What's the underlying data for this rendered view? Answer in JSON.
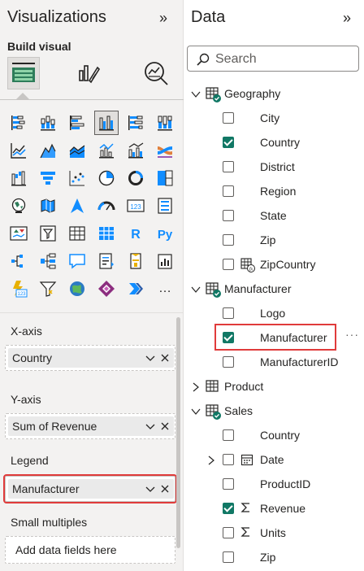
{
  "viz": {
    "title": "Visualizations",
    "collapse_glyph": "»",
    "build_label": "Build visual",
    "wells": {
      "xaxis_label": "X-axis",
      "xaxis_value": "Country",
      "yaxis_label": "Y-axis",
      "yaxis_value": "Sum of Revenue",
      "legend_label": "Legend",
      "legend_value": "Manufacturer",
      "small_multiples_label": "Small multiples",
      "small_multiples_placeholder": "Add data fields here"
    },
    "grid_icons": [
      "stacked-bar-chart-icon",
      "stacked-column-chart-icon",
      "clustered-bar-chart-icon",
      "clustered-column-chart-icon",
      "100-stacked-bar-chart-icon",
      "100-stacked-column-chart-icon",
      "line-chart-icon",
      "area-chart-icon",
      "stacked-area-chart-icon",
      "line-and-column-chart-icon",
      "line-and-clustered-column-chart-icon",
      "ribbon-chart-icon",
      "waterfall-chart-icon",
      "funnel-chart-icon",
      "scatter-chart-icon",
      "pie-chart-icon",
      "donut-chart-icon",
      "treemap-icon",
      "map-icon",
      "filled-map-icon",
      "azure-map-icon",
      "gauge-icon",
      "card-icon",
      "multi-row-card-icon",
      "kpi-icon",
      "slicer-icon",
      "table-icon",
      "matrix-icon",
      "r-visual-icon",
      "python-visual-icon",
      "decomposition-tree-icon",
      "key-influencers-icon",
      "qa-icon",
      "smart-narrative-icon",
      "paginated-report-icon",
      "power-apps-icon",
      "power-automate-icon",
      "filter-slicer-icon",
      "arcgis-map-icon",
      "power-apps-diamond-icon",
      "get-more-visuals-icon",
      "more-options-icon"
    ],
    "selected_icon": "clustered-column-chart-icon",
    "grid_text": {
      "card": "123",
      "r": "R",
      "py": "Py",
      "more": "…"
    }
  },
  "data": {
    "title": "Data",
    "collapse_glyph": "»",
    "search_placeholder": "Search",
    "more_glyph": "···",
    "tables": [
      {
        "name": "Geography",
        "expanded": true,
        "fields": [
          {
            "name": "City",
            "checked": false
          },
          {
            "name": "Country",
            "checked": true
          },
          {
            "name": "District",
            "checked": false
          },
          {
            "name": "Region",
            "checked": false
          },
          {
            "name": "State",
            "checked": false
          },
          {
            "name": "Zip",
            "checked": false
          },
          {
            "name": "ZipCountry",
            "checked": false
          }
        ]
      },
      {
        "name": "Manufacturer",
        "expanded": true,
        "fields": [
          {
            "name": "Logo",
            "checked": false
          },
          {
            "name": "Manufacturer",
            "checked": true
          },
          {
            "name": "ManufacturerID",
            "checked": false
          }
        ]
      },
      {
        "name": "Product",
        "expanded": false,
        "fields": []
      },
      {
        "name": "Sales",
        "expanded": true,
        "fields": [
          {
            "name": "Country",
            "checked": false
          },
          {
            "name": "Date",
            "checked": false
          },
          {
            "name": "ProductID",
            "checked": false
          },
          {
            "name": "Revenue",
            "checked": true
          },
          {
            "name": "Units",
            "checked": false
          },
          {
            "name": "Zip",
            "checked": false
          }
        ]
      }
    ]
  },
  "colors": {
    "accent": "#117865",
    "highlight": "#e03b3b",
    "icon_blue": "#118dff",
    "icon_dark": "#252423"
  }
}
